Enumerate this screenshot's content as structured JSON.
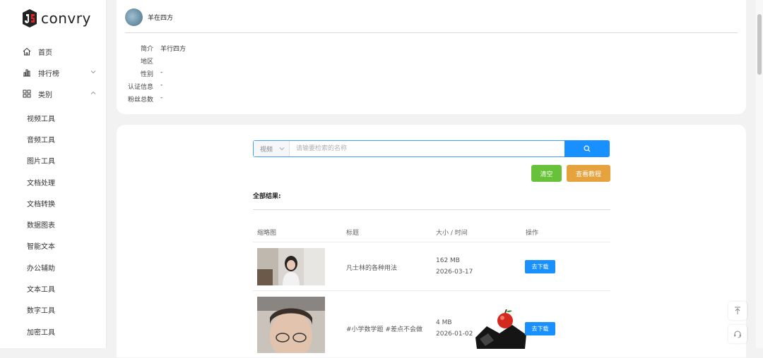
{
  "brand": {
    "name": "convry"
  },
  "nav": {
    "items": [
      {
        "label": "首页",
        "icon": "home-icon"
      },
      {
        "label": "排行榜",
        "icon": "chart-bar-icon"
      },
      {
        "label": "类别",
        "icon": "grid-icon"
      }
    ],
    "sub_items": [
      "视频工具",
      "音频工具",
      "图片工具",
      "文档处理",
      "文档转换",
      "数据图表",
      "智能文本",
      "办公辅助",
      "文本工具",
      "数字工具",
      "加密工具"
    ]
  },
  "profile": {
    "name": "羊在四方",
    "fields": [
      {
        "label": "简介",
        "value": "羊行四方"
      },
      {
        "label": "地区",
        "value": ""
      },
      {
        "label": "性别",
        "value": "-"
      },
      {
        "label": "认证信息",
        "value": "-"
      },
      {
        "label": "粉丝总数",
        "value": "-"
      }
    ]
  },
  "search": {
    "type_value": "视频",
    "placeholder": "请输要检索的名称",
    "clear_label": "清空",
    "tutorial_label": "查看教程"
  },
  "results": {
    "title": "全部结果:",
    "headers": [
      "缩略图",
      "标题",
      "大小 / 时间",
      "操作"
    ],
    "rows": [
      {
        "title": "凡士林的各种用法",
        "size": "162 MB",
        "date": "2026-03-17",
        "action": "去下载"
      },
      {
        "title": "#小学数学题 #差点不会做",
        "size": "4 MB",
        "date": "2026-01-02",
        "action": "去下载"
      }
    ]
  },
  "colors": {
    "primary": "#1890ff",
    "success": "#67c23a",
    "warning": "#e6a23c"
  }
}
